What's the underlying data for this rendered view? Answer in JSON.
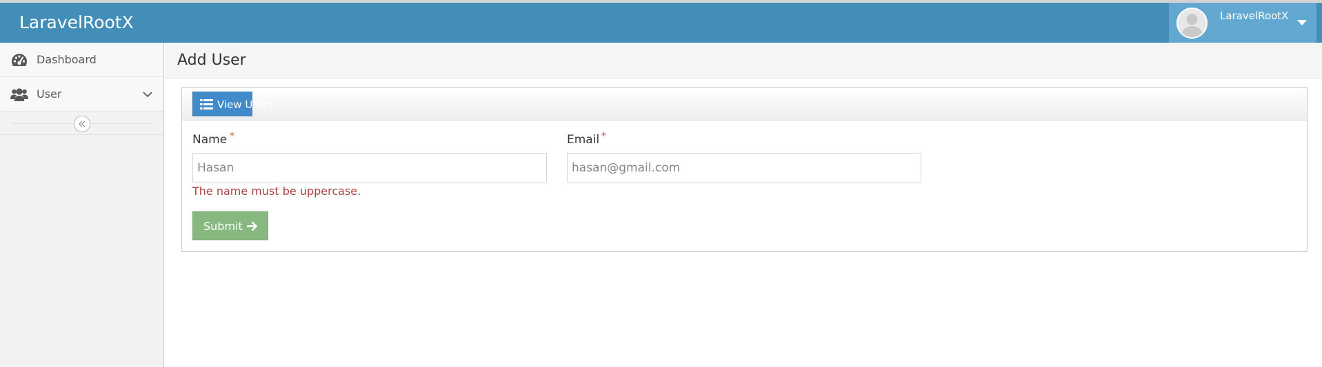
{
  "navbar": {
    "brand": "LaravelRootX",
    "user_name": "LaravelRootX",
    "avatar_icon": "user-avatar-icon",
    "color": "#438eb9",
    "user_menu_color": "#62a8d1"
  },
  "sidebar": {
    "items": [
      {
        "label": "Dashboard",
        "icon": "tachometer-icon"
      },
      {
        "label": "User",
        "icon": "users-icon",
        "expand_icon": "chevron-down-icon"
      }
    ],
    "collapse_icon": "double-chevron-left-icon"
  },
  "page": {
    "title": "Add User"
  },
  "form": {
    "view_users_label": "View Users",
    "view_users_icon": "list-icon",
    "name": {
      "label": "Name",
      "required_mark": "*",
      "value": "",
      "placeholder": "Hasan",
      "error": "The name must be uppercase."
    },
    "email": {
      "label": "Email",
      "required_mark": "*",
      "value": "",
      "placeholder": "hasan@gmail.com"
    },
    "submit_label": "Submit",
    "submit_icon": "arrow-right-icon",
    "submit_color": "#87b87f",
    "error_color": "#a94442"
  }
}
